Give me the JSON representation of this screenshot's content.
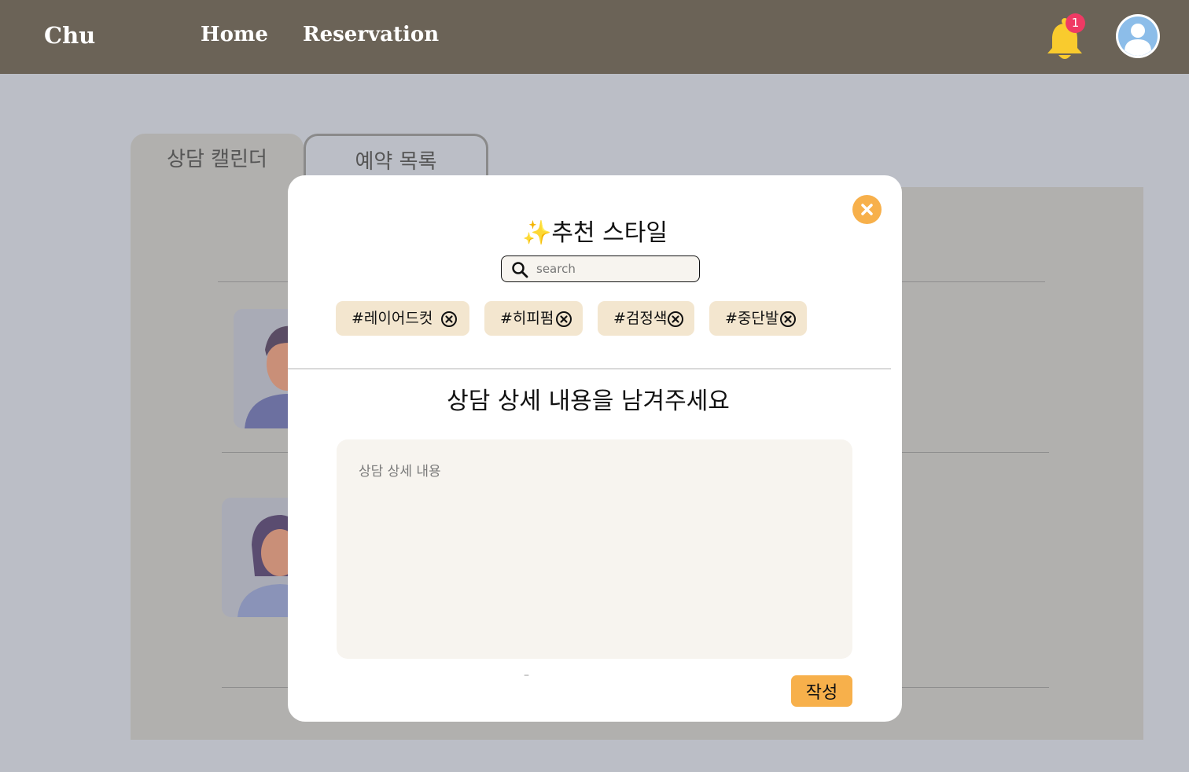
{
  "nav": {
    "brand": "Chu",
    "links": [
      "Home",
      "Reservation"
    ],
    "notification_count": "1",
    "bell_color": "#f9cb2e",
    "avatar_color": "#8cbde9"
  },
  "tabs": [
    "상담 캘린더",
    "예약 목록"
  ],
  "modal": {
    "sparkle": "✨",
    "title": "추천 스타일",
    "search_placeholder": "search",
    "tags": [
      "#레이어드컷",
      "#히피펌",
      "#검정색",
      "#중단발"
    ],
    "section_title": "상담 상세 내용을 남겨주세요",
    "detail_placeholder": "상담 상세 내용",
    "dash": "–",
    "submit_label": "작성"
  },
  "colors": {
    "nav_bg": "#6b6357",
    "accent": "#f7b04b",
    "chip_bg": "#f3e6cf",
    "badge": "#ef3a64"
  }
}
